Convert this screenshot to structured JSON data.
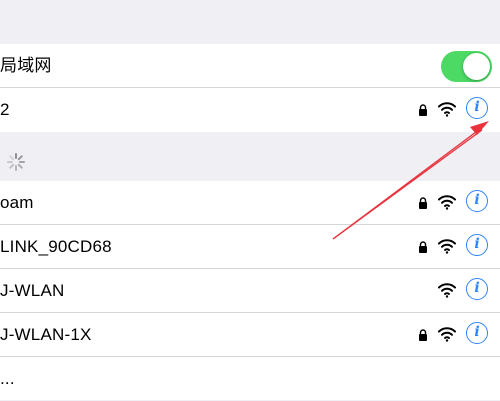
{
  "top_row": {
    "label": "局域网",
    "toggle_on": true
  },
  "current_network": {
    "name": "2",
    "locked": true
  },
  "networks": [
    {
      "name": "oam",
      "locked": true
    },
    {
      "name": "LINK_90CD68",
      "locked": true
    },
    {
      "name": "J-WLAN",
      "locked": false
    },
    {
      "name": "J-WLAN-1X",
      "locked": true
    }
  ],
  "other_row": {
    "label": "..."
  },
  "colors": {
    "accent": "#2f86f6",
    "toggle_on": "#4cd964",
    "annotation": "#e8323c",
    "background": "#efeff4"
  },
  "icons": {
    "lock": "lock-icon",
    "wifi": "wifi-icon",
    "info": "info-icon",
    "spinner": "spinner-icon"
  }
}
